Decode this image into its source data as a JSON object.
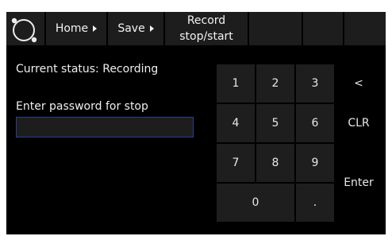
{
  "topbar": {
    "home_label": "Home",
    "save_label": "Save",
    "record_label_line1": "Record",
    "record_label_line2": "stop/start",
    "logo_icon": "circle-logo-icon"
  },
  "main": {
    "status_text": "Current status: Recording",
    "password_prompt": "Enter password for stop",
    "password_value": ""
  },
  "keypad": {
    "k1": "1",
    "k2": "2",
    "k3": "3",
    "k4": "4",
    "k5": "5",
    "k6": "6",
    "k7": "7",
    "k8": "8",
    "k9": "9",
    "k0": "0",
    "kdot": ".",
    "backspace": "<",
    "clear": "CLR",
    "enter": "Enter"
  },
  "colors": {
    "screen_bg": "#000000",
    "button_bg": "#1e1e1e",
    "input_border": "#2c3f8f",
    "text": "#f0f0f0"
  }
}
